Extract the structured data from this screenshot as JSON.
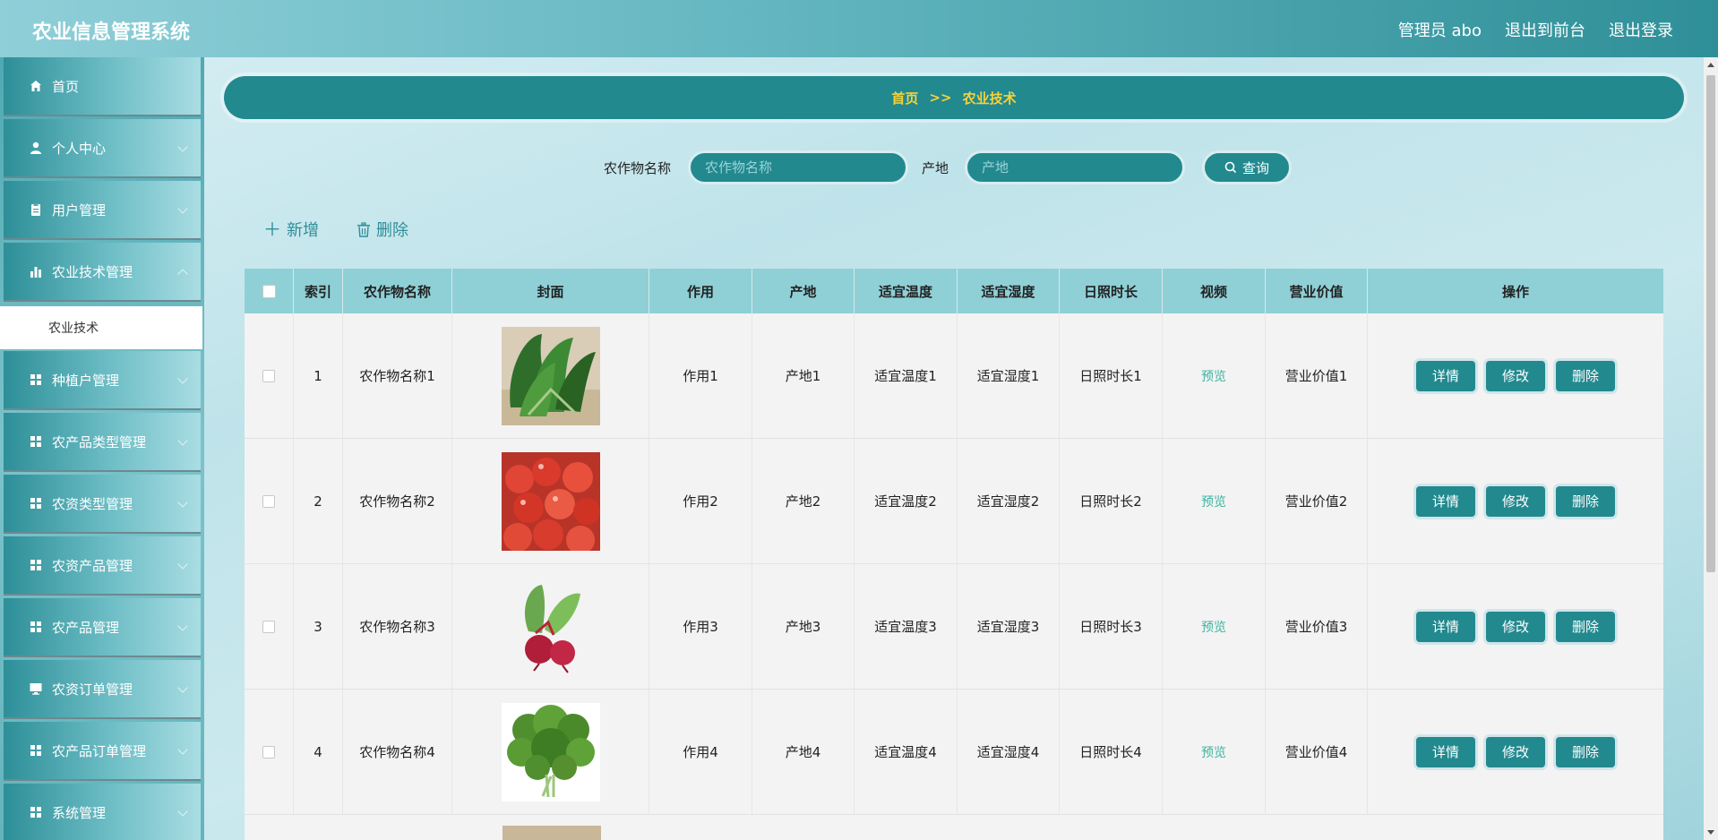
{
  "app": {
    "title": "农业信息管理系统",
    "admin_label": "管理员 abo",
    "frontend_label": "退出到前台",
    "logout_label": "退出登录"
  },
  "sidebar": {
    "items": [
      {
        "label": "首页",
        "icon": "home-icon"
      },
      {
        "label": "个人中心",
        "icon": "user-icon"
      },
      {
        "label": "用户管理",
        "icon": "clipboard-icon"
      },
      {
        "label": "农业技术管理",
        "icon": "bar-chart-icon"
      },
      {
        "label": "种植户管理",
        "icon": "grid-icon"
      },
      {
        "label": "农产品类型管理",
        "icon": "grid-icon"
      },
      {
        "label": "农资类型管理",
        "icon": "grid-icon"
      },
      {
        "label": "农资产品管理",
        "icon": "grid-icon"
      },
      {
        "label": "农产品管理",
        "icon": "grid-icon"
      },
      {
        "label": "农资订单管理",
        "icon": "monitor-icon"
      },
      {
        "label": "农产品订单管理",
        "icon": "grid-icon"
      },
      {
        "label": "系统管理",
        "icon": "grid-icon"
      }
    ],
    "active_sub": "农业技术"
  },
  "breadcrumb": {
    "home": "首页",
    "separator": ">>",
    "current": "农业技术"
  },
  "search": {
    "crop_label": "农作物名称",
    "crop_placeholder": "农作物名称",
    "origin_label": "产地",
    "origin_placeholder": "产地",
    "button": "查询"
  },
  "actions": {
    "add": "新增",
    "delete": "删除"
  },
  "table": {
    "headers": [
      "索引",
      "农作物名称",
      "封面",
      "作用",
      "产地",
      "适宜温度",
      "适宜湿度",
      "日照时长",
      "视频",
      "营业价值",
      "操作"
    ],
    "rows": [
      {
        "index": "1",
        "name": "农作物名称1",
        "cover": "green-leafy-vegetable",
        "effect": "作用1",
        "origin": "产地1",
        "temp": "适宜温度1",
        "humidity": "适宜湿度1",
        "sunlight": "日照时长1",
        "video": "预览",
        "value": "营业价值1"
      },
      {
        "index": "2",
        "name": "农作物名称2",
        "cover": "red-cherries",
        "effect": "作用2",
        "origin": "产地2",
        "temp": "适宜温度2",
        "humidity": "适宜湿度2",
        "sunlight": "日照时长2",
        "video": "预览",
        "value": "营业价值2"
      },
      {
        "index": "3",
        "name": "农作物名称3",
        "cover": "beetroot",
        "effect": "作用3",
        "origin": "产地3",
        "temp": "适宜温度3",
        "humidity": "适宜湿度3",
        "sunlight": "日照时长3",
        "video": "预览",
        "value": "营业价值3"
      },
      {
        "index": "4",
        "name": "农作物名称4",
        "cover": "parsley-bunch",
        "effect": "作用4",
        "origin": "产地4",
        "temp": "适宜温度4",
        "humidity": "适宜湿度4",
        "sunlight": "日照时长4",
        "video": "预览",
        "value": "营业价值4"
      }
    ],
    "row_actions": {
      "detail": "详情",
      "edit": "修改",
      "delete": "删除"
    }
  },
  "colors": {
    "primary": "#22898f",
    "breadcrumb_text": "#f5d23a",
    "table_header": "#8fd0d7",
    "preview_link": "#3cb4a0"
  }
}
